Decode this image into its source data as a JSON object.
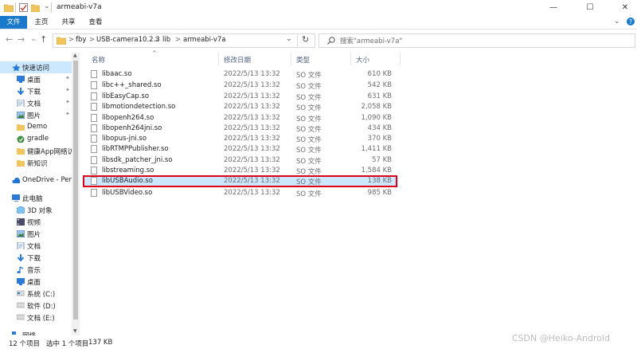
{
  "window": {
    "title": "armeabi-v7a",
    "minimize_glyph": "—",
    "maximize_glyph": "☐",
    "close_glyph": "✕",
    "help_glyph": "?",
    "expand_glyph": "⌄"
  },
  "ribbon": {
    "tabs": [
      {
        "label": "文件",
        "active": true
      },
      {
        "label": "主页",
        "active": false
      },
      {
        "label": "共享",
        "active": false
      },
      {
        "label": "查看",
        "active": false
      }
    ]
  },
  "nav": {
    "back": "←",
    "forward": "→",
    "recent": "⌄",
    "up": "↑",
    "breadcrumbs": [
      "fby",
      "USB-camera10.2.3",
      "lib",
      "armeabi-v7a"
    ],
    "separator": ">",
    "dropdown": "⌄",
    "refresh": "↻",
    "search_placeholder": "搜索\"armeabi-v7a\""
  },
  "sidebar": {
    "quick_access": "快速访问",
    "quick_items": [
      {
        "label": "桌面",
        "icon": "desktop-icon",
        "pinned": true
      },
      {
        "label": "下载",
        "icon": "download-icon",
        "pinned": true
      },
      {
        "label": "文档",
        "icon": "documents-icon",
        "pinned": true
      },
      {
        "label": "图片",
        "icon": "pictures-icon",
        "pinned": true
      },
      {
        "label": "Demo",
        "icon": "folder-icon",
        "pinned": false
      },
      {
        "label": "gradle",
        "icon": "gradle-icon",
        "pinned": false
      },
      {
        "label": "健康App网络访",
        "icon": "folder-icon",
        "pinned": false
      },
      {
        "label": "新知识",
        "icon": "folder-icon",
        "pinned": false
      }
    ],
    "onedrive": "OneDrive - Perso",
    "this_pc": "此电脑",
    "pc_items": [
      {
        "label": "3D 对象",
        "icon": "3d-objects-icon"
      },
      {
        "label": "视频",
        "icon": "videos-icon"
      },
      {
        "label": "图片",
        "icon": "pictures-icon"
      },
      {
        "label": "文档",
        "icon": "documents-icon"
      },
      {
        "label": "下载",
        "icon": "download-icon"
      },
      {
        "label": "音乐",
        "icon": "music-icon"
      },
      {
        "label": "桌面",
        "icon": "desktop-icon"
      },
      {
        "label": "系统 (C:)",
        "icon": "drive-icon"
      },
      {
        "label": "软件 (D:)",
        "icon": "drive-icon"
      },
      {
        "label": "文档 (E:)",
        "icon": "drive-icon"
      }
    ],
    "network": "网络"
  },
  "columns": {
    "name": "名称",
    "date": "修改日期",
    "type": "类型",
    "size": "大小",
    "sort_glyph": "^"
  },
  "files": [
    {
      "name": "libaac.so",
      "date": "2022/5/13 13:32",
      "type": "SO 文件",
      "size": "610 KB"
    },
    {
      "name": "libc++_shared.so",
      "date": "2022/5/13 13:32",
      "type": "SO 文件",
      "size": "542 KB"
    },
    {
      "name": "libEasyCap.so",
      "date": "2022/5/13 13:32",
      "type": "SO 文件",
      "size": "631 KB"
    },
    {
      "name": "libmotiondetection.so",
      "date": "2022/5/13 13:32",
      "type": "SO 文件",
      "size": "2,058 KB"
    },
    {
      "name": "libopenh264.so",
      "date": "2022/5/13 13:32",
      "type": "SO 文件",
      "size": "1,090 KB"
    },
    {
      "name": "libopenh264jni.so",
      "date": "2022/5/13 13:32",
      "type": "SO 文件",
      "size": "434 KB"
    },
    {
      "name": "libopus-jni.so",
      "date": "2022/5/13 13:32",
      "type": "SO 文件",
      "size": "370 KB"
    },
    {
      "name": "libRTMPPublisher.so",
      "date": "2022/5/13 13:32",
      "type": "SO 文件",
      "size": "1,411 KB"
    },
    {
      "name": "libsdk_patcher_jni.so",
      "date": "2022/5/13 13:32",
      "type": "SO 文件",
      "size": "57 KB"
    },
    {
      "name": "libstreaming.so",
      "date": "2022/5/13 13:32",
      "type": "SO 文件",
      "size": "1,584 KB"
    },
    {
      "name": "libUSBAudio.so",
      "date": "2022/5/13 13:32",
      "type": "SO 文件",
      "size": "138 KB",
      "selected": true
    },
    {
      "name": "libUSBVideo.so",
      "date": "2022/5/13 13:32",
      "type": "SO 文件",
      "size": "985 KB"
    }
  ],
  "status": {
    "count": "12 个项目",
    "selection": "选中 1 个项目",
    "size": "137 KB"
  },
  "watermark": "CSDN @Heiko-Android",
  "colors": {
    "accent": "#1979ca",
    "selection": "#cce8ff",
    "highlight_box": "#e0001a",
    "folder": "#f2c55c"
  }
}
